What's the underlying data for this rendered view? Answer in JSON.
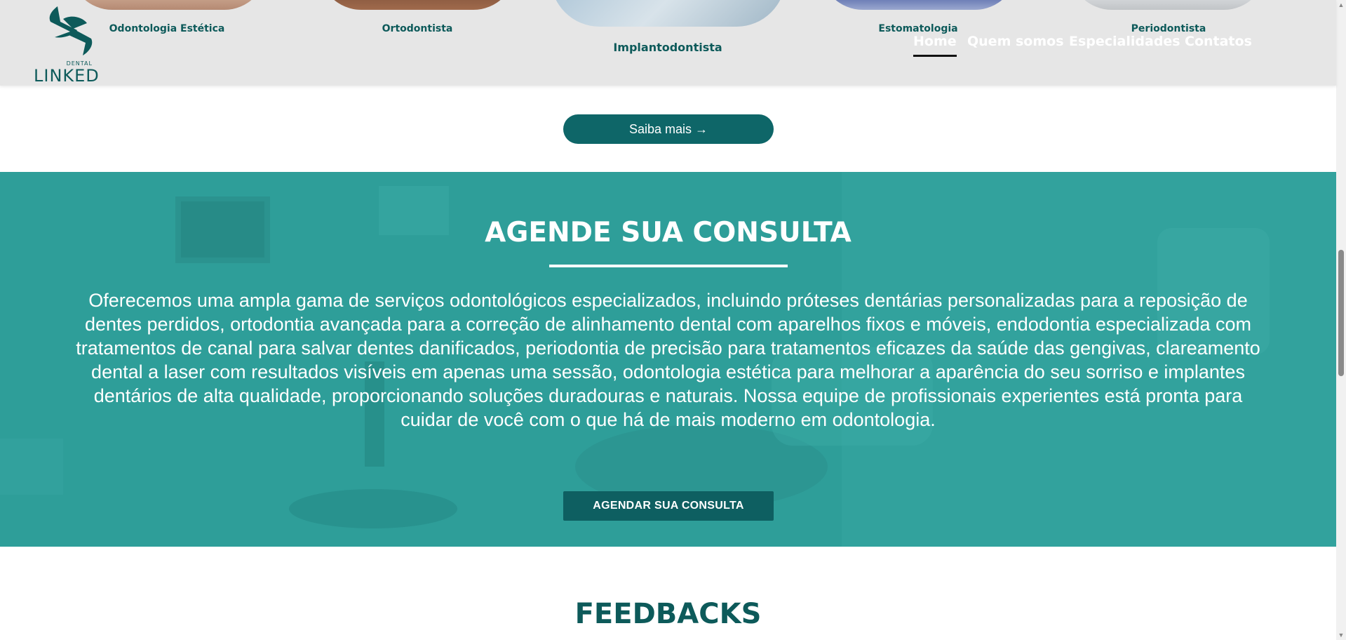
{
  "header": {
    "logo": {
      "small": "DENTAL",
      "big": "LINKED"
    },
    "specialties": [
      {
        "label": "Odontologia Estética"
      },
      {
        "label": "Ortodontista"
      },
      {
        "label": "Implantodontista"
      },
      {
        "label": "Estomatologia"
      },
      {
        "label": "Periodontista"
      }
    ],
    "nav": [
      {
        "label": "Home",
        "active": true
      },
      {
        "label": "Quem somos"
      },
      {
        "label": "Especialidades"
      },
      {
        "label": "Contatos"
      }
    ]
  },
  "saiba_mais": {
    "label": "Saiba mais →"
  },
  "agende": {
    "title": "AGENDE SUA CONSULTA",
    "text": "Oferecemos uma ampla gama de serviços odontológicos especializados, incluindo próteses dentárias personalizadas para a reposição de dentes perdidos, ortodontia avançada para a correção de alinhamento dental com aparelhos fixos e móveis, endodontia especializada com tratamentos de canal para salvar dentes danificados, periodontia de precisão para tratamentos eficazes da saúde das gengivas, clareamento dental a laser com resultados visíveis em apenas uma sessão, odontologia estética para melhorar a aparência do seu sorriso e implantes dentários de alta qualidade, proporcionando soluções duradouras e naturais. Nossa equipe de profissionais experientes está pronta para cuidar de você com o que há de mais moderno em odontologia.",
    "button": "AGENDAR SUA CONSULTA"
  },
  "feedbacks": {
    "title": "FEEDBACKS"
  },
  "colors": {
    "brand": "#0d5a5a",
    "teal_overlay": "#2d9d98",
    "header_bg": "#e6e6e6"
  },
  "icons": [
    "logo-mark-icon",
    "chevron-up-icon",
    "chevron-down-icon"
  ]
}
